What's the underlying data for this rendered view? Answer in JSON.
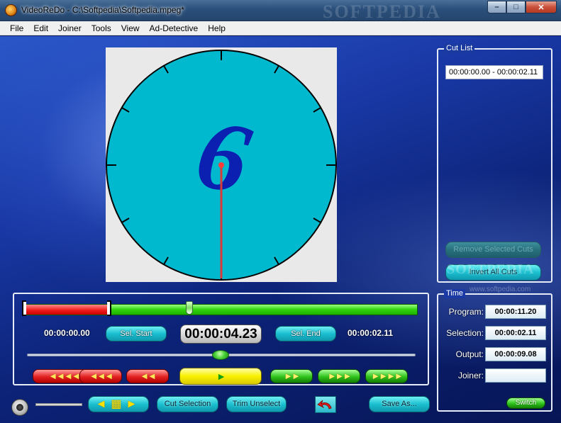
{
  "window": {
    "title": "VideoReDo - C:\\Softpedia\\Softpedia.mpeg*",
    "watermark": "SOFTPEDIA",
    "controls": {
      "minimize": "–",
      "maximize": "□",
      "close": "✕"
    }
  },
  "menu": [
    "File",
    "Edit",
    "Joiner",
    "Tools",
    "View",
    "Ad-Detective",
    "Help"
  ],
  "video": {
    "frame_digit": "6"
  },
  "cut_list": {
    "legend": "Cut List",
    "entries": [
      "00:00:00.00 - 00:00:02.11"
    ],
    "remove_label": "Remove Selected Cuts",
    "invert_label": "Invert All Cuts",
    "watermark": "SOFTPEDIA",
    "watermark_url": "www.softpedia.com"
  },
  "timeline": {
    "progress_fraction": 0.38,
    "selection_fraction": 0.217,
    "start_time": "00:00:00.00",
    "current_time": "00:00:04.23",
    "end_time": "00:00:02.11",
    "sel_start_label": "Sel. Start",
    "sel_end_label": "Sel. End",
    "jog_fraction": 0.5,
    "rewind_4": "◄◄◄◄",
    "rewind_3": "◄◄◄",
    "rewind_2": "◄◄",
    "play": "►",
    "forward_2": "►►",
    "forward_3": "►►►",
    "forward_4": "►►►►"
  },
  "time_panel": {
    "legend": "Time",
    "program_label": "Program:",
    "program_value": "00:00:11.20",
    "selection_label": "Selection:",
    "selection_value": "00:00:02.11",
    "output_label": "Output:",
    "output_value": "00:00:09.08",
    "joiner_label": "Joiner:",
    "joiner_value": "",
    "switch_label": "Switch"
  },
  "toolbar": {
    "scene_label": "◄▦►",
    "cut_selection_label": "Cut Selection",
    "trim_unselect_label": "Trim Unselect",
    "save_as_label": "Save As..."
  },
  "colors": {
    "clock_face": "#00b9cf",
    "digit": "#0b1fb0",
    "hand": "#d93a3a",
    "selection": "#f01d1d",
    "progress": "#2fd40d"
  }
}
